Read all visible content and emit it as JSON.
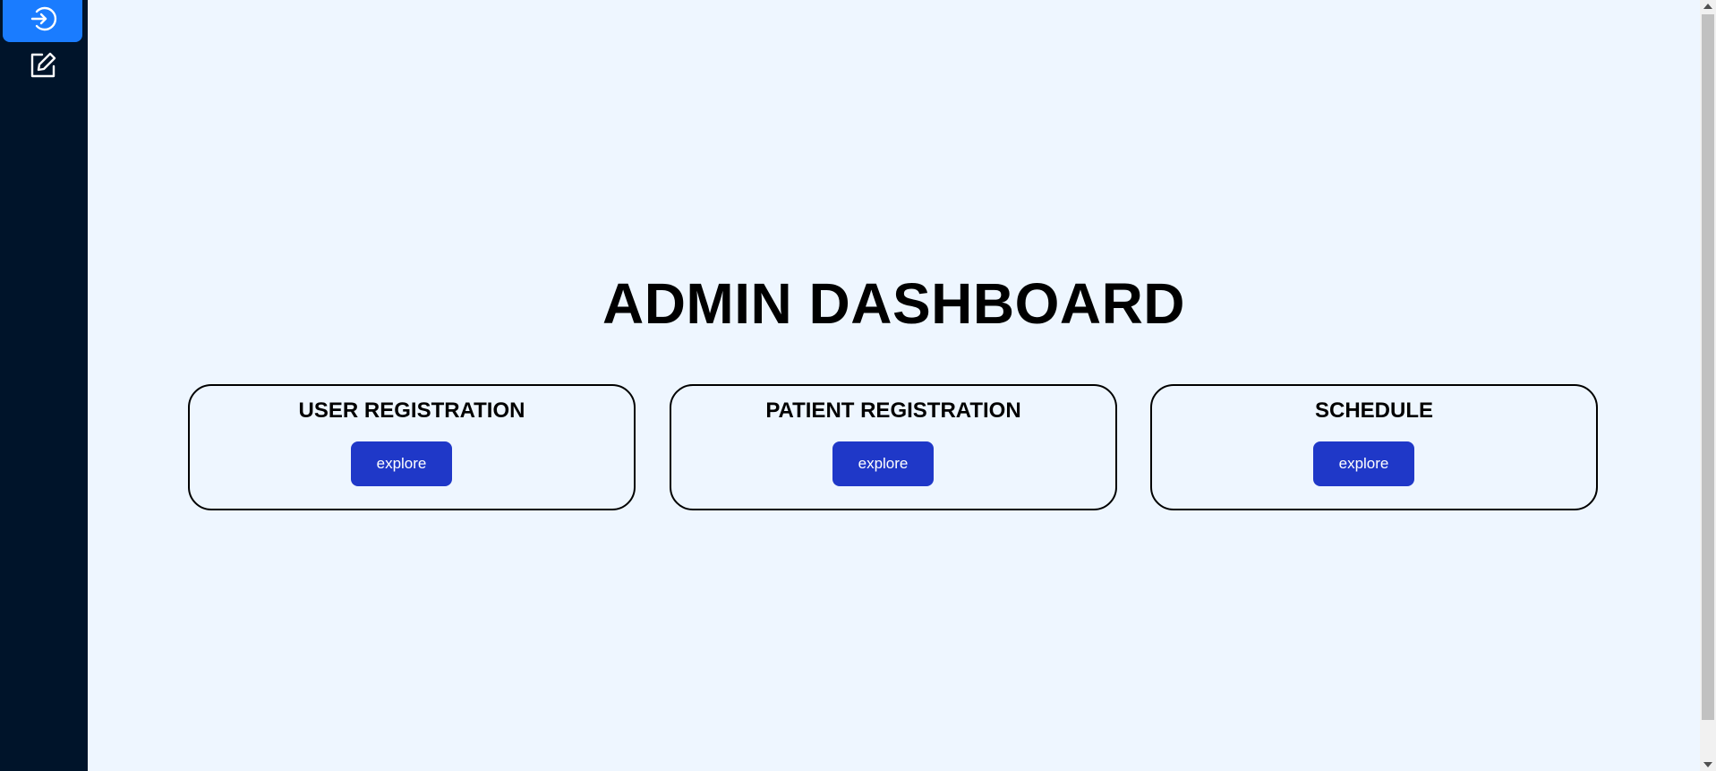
{
  "sidebar": {
    "items": [
      {
        "icon": "sign-in-icon",
        "active": true
      },
      {
        "icon": "edit-icon",
        "active": false
      }
    ],
    "active_color": "#1a7cff",
    "background": "#00142a"
  },
  "main": {
    "title": "ADMIN DASHBOARD",
    "cards": [
      {
        "title": "USER REGISTRATION",
        "button_label": "explore"
      },
      {
        "title": "PATIENT REGISTRATION",
        "button_label": "explore"
      },
      {
        "title": "SCHEDULE",
        "button_label": "explore"
      }
    ],
    "button_color": "#1f38c8",
    "background": "#eef6ff"
  }
}
